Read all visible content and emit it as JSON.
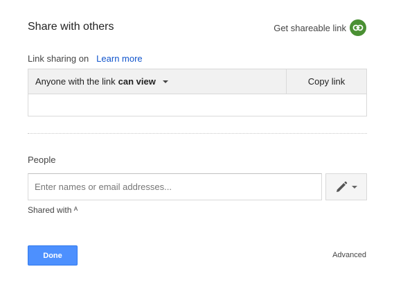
{
  "dialog": {
    "title": "Share with others",
    "get_link_label": "Get shareable link",
    "icon": "link-icon",
    "accent_color": "#4a9033"
  },
  "link_sharing": {
    "status": "Link sharing on",
    "learn_more": "Learn more",
    "access_prefix": "Anyone with the link",
    "access_level": "can view",
    "copy_label": "Copy link",
    "url": ""
  },
  "people": {
    "label": "People",
    "input_value": "",
    "placeholder": "Enter names or email addresses...",
    "edit_icon": "pencil-icon",
    "shared_with": "Shared with ᴬ"
  },
  "footer": {
    "done_label": "Done",
    "done_color": "#4d90fe",
    "advanced_label": "Advanced"
  }
}
